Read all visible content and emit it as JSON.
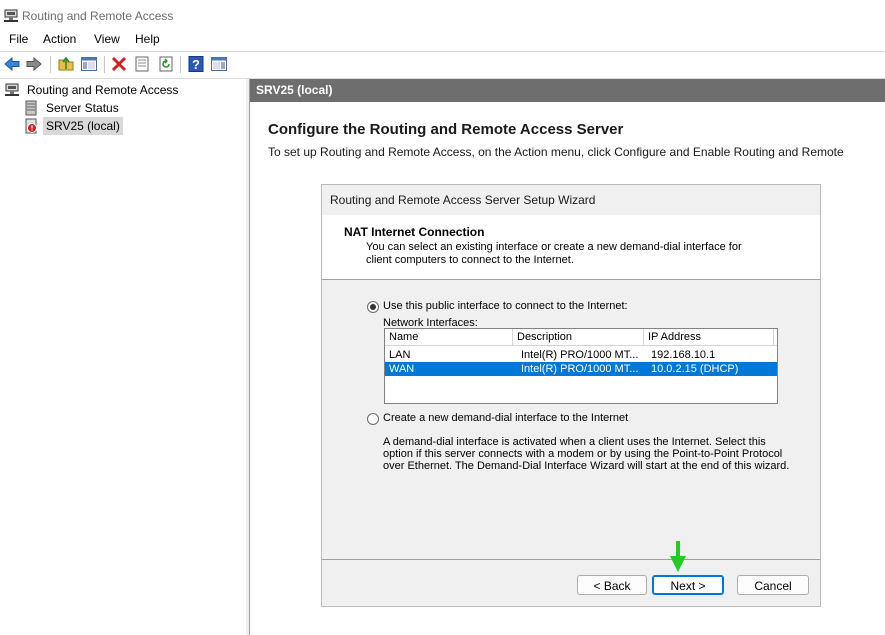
{
  "window": {
    "title": "Routing and Remote Access"
  },
  "menu": {
    "items": [
      "File",
      "Action",
      "View",
      "Help"
    ]
  },
  "toolbar": {
    "icons": [
      "back-icon",
      "forward-icon",
      "up-folder-icon",
      "show-hide-tree-icon",
      "delete-icon",
      "properties-icon",
      "refresh-icon",
      "help-icon",
      "show-hide-action-pane-icon"
    ]
  },
  "tree": {
    "root": "Routing and Remote Access",
    "items": [
      "Server Status",
      "SRV25 (local)"
    ]
  },
  "right": {
    "header": "SRV25 (local)",
    "heading": "Configure the Routing and Remote Access Server",
    "subtext": "To set up Routing and Remote Access, on the Action menu, click Configure and Enable Routing and Remote"
  },
  "wizard": {
    "title": "Routing and Remote Access Server Setup Wizard",
    "page_heading": "NAT Internet Connection",
    "page_desc": "You can select an existing interface or create a new demand-dial interface for client computers to connect to the Internet.",
    "option1": "Use this public interface to connect to the Internet:",
    "interfaces_label": "Network Interfaces:",
    "columns": [
      "Name",
      "Description",
      "IP Address"
    ],
    "rows": [
      {
        "name": "LAN",
        "description": "Intel(R) PRO/1000 MT...",
        "ip": "192.168.10.1"
      },
      {
        "name": "WAN",
        "description": "Intel(R) PRO/1000 MT...",
        "ip": "10.0.2.15 (DHCP)"
      }
    ],
    "option2": "Create a new demand-dial interface to the Internet",
    "option2_desc": "A demand-dial interface is activated when a client uses the Internet. Select this option if this server connects with a modem or by using the Point-to-Point Protocol over Ethernet. The Demand-Dial Interface Wizard will start at the end of this wizard.",
    "back": "< Back",
    "next": "Next >",
    "cancel": "Cancel"
  },
  "colors": {
    "selection": "#0078d7",
    "header_bar": "#6e6e6e",
    "annotation_arrow": "#22cc22"
  }
}
